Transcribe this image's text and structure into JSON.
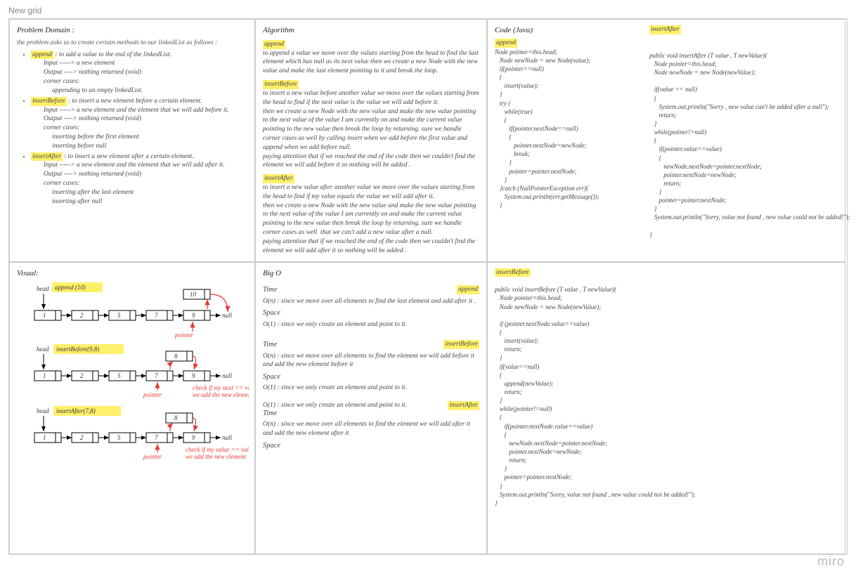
{
  "page": {
    "title": "New grid",
    "brand": "miro"
  },
  "problem": {
    "heading": "Problem Domain :",
    "intro": "the problem asks us to create certain methods to our linkedList as follows :",
    "items": [
      {
        "name": "append",
        "def": ": to add a value to the end of the linkedList.",
        "input": "Input -----> a new element",
        "output": "Output ----> nothing returned (void)",
        "corner": "corner cases:",
        "cases": [
          "appending to an empty linkedList."
        ]
      },
      {
        "name": "insertBefore",
        "def": ": to insert a new element before a certain element.",
        "input": "Input -----> a new element and the element that we will add before it.",
        "output": "Output ----> nothing returned (void)",
        "corner": "corner cases:",
        "cases": [
          "inserting before the first element",
          "inserting before null"
        ]
      },
      {
        "name": "insertAfter",
        "def": ": to insert a new element after a certain element.",
        "input": "Input -----> a new element and the element that we will add after it.",
        "output": "Output ----> nothing returned (void)",
        "corner": "corner cases:",
        "cases": [
          "inserting after the last element",
          "inserting after null"
        ]
      }
    ]
  },
  "algorithm": {
    "heading": "Algorithm",
    "sections": [
      {
        "name": "append",
        "text": "to append a value we move over the values starting from the head to find the last element which has null as its next value then we create a new Node with the new value and make the last element pointing to it and break the loop."
      },
      {
        "name": "insertBefore",
        "text": "to insert a new value before another value we move over the values starting from the head to find if the next value is the value we will add before it.\nthen we create a new Node with the new value and make the new value pointing to the next value of the value I am currently on and make the current value pointing to the new value then break the loop by returning. sure we handle corner cases as well by calling insert when we add before the first value and append when we add before null.\npaying attention that if we reached the end of the code then we couldn't find the element we will add before it so nothing will be added ."
      },
      {
        "name": "insertAfter",
        "text": "to insert a new value after another value we move over the values starting from the head to find if my value equals the value we will add after it.\nthen we create a new Node with the new value and make the new value pointing to the next value of the value I am currently on and make the current value pointing to the new value then break the loop by returning. sure we handle corner cases as well  that we can't add a new value after a null.\npaying attention that if we reached the end of the code then we couldn't find the element we will add after it so nothing will be added ."
      }
    ]
  },
  "code_top": {
    "heading": "Code (Java)",
    "left_name": "append",
    "left": "Node pointer=this.head;\n   Node newNode = new Node(value);\n   if(pointer==null)\n   {\n      insert(value);\n   }\n   try {\n      while(true)\n      {\n         if(pointer.nextNode==null)\n         {\n            pointer.nextNode=newNode;\n            break;\n         }\n         pointer=pointer.nextNode;\n      }\n   }catch (NullPointerException err){\n      System.out.println(err.getMessage());\n   }",
    "right_name": "insertAfter",
    "right": "public void insertAfter (T value , T newValue){\n   Node pointer=this.head;\n   Node newNode = new Node(newValue);\n\n   if(value == null)\n   {\n      System.out.println(\"Sorry , new value can't be added after a null\");\n      return;\n   }\n   while(pointer!=null)\n   {\n      if(pointer.value==value)\n      {\n         newNode.nextNode=pointer.nextNode;\n         pointer.nextNode=newNode;\n         return;\n      }\n      pointer=pointer.nextNode;\n   }\n   System.out.println(\"Sorry, value not found , new value could not be added!\");\n\n}"
  },
  "visual": {
    "heading": "Visual:",
    "labels": {
      "append": "append (10)",
      "insertBefore": "insertBefore(9,8)",
      "insertAfter": "insertAfter(7,8)",
      "head": "head",
      "null": "null",
      "pointer": "pointer",
      "check_next": "check if my next == value\nwe add the new element",
      "check_value": "check if my value == value\nwe add the new element"
    },
    "nodes_row": [
      "1",
      "2",
      "5",
      "7",
      "9"
    ],
    "new_node_10": "10",
    "new_node_8": "8"
  },
  "bigo": {
    "heading": "Big O",
    "blocks": [
      {
        "name": "append",
        "time": "O(n) : since we move over all elements to find the last element and add after it .",
        "space": "O(1) : since we only create an element and point to it."
      },
      {
        "name": "insertBefore",
        "time": "O(n) : since we move over all elements to find the element we will add before it and add the new element before it",
        "space": "O(1) : since we only create an element and point to it."
      },
      {
        "name": "insertAfter",
        "time_pre": "O(1) : since we only create an element and point to it.",
        "time": "O(n) : since we move over all elements to find the element we will add after it and add the new element after it",
        "space_label_only": "Space"
      }
    ],
    "labels": {
      "time": "Time",
      "space": "Space"
    }
  },
  "code_bottom": {
    "name": "insertBefore",
    "code": "public void insertBefore (T value , T newValue){\n   Node pointer=this.head;\n   Node newNode = new Node(newValue);\n\n   if (pointer.nextNode.value==value)\n   {\n      insert(value);\n      return;\n   }\n   if(value==null)\n   {\n      append(newValue);\n      return;\n   }\n   while(pointer!=null)\n   {\n      if(pointer.nextNode.value==value)\n      {\n         newNode.nextNode=pointer.nextNode;\n         pointer.nextNode=newNode;\n         return;\n      }\n      pointer=pointer.nextNode;\n   }\n   System.out.println(\"Sorry, value not found , new value could not be added!\");\n}"
  }
}
